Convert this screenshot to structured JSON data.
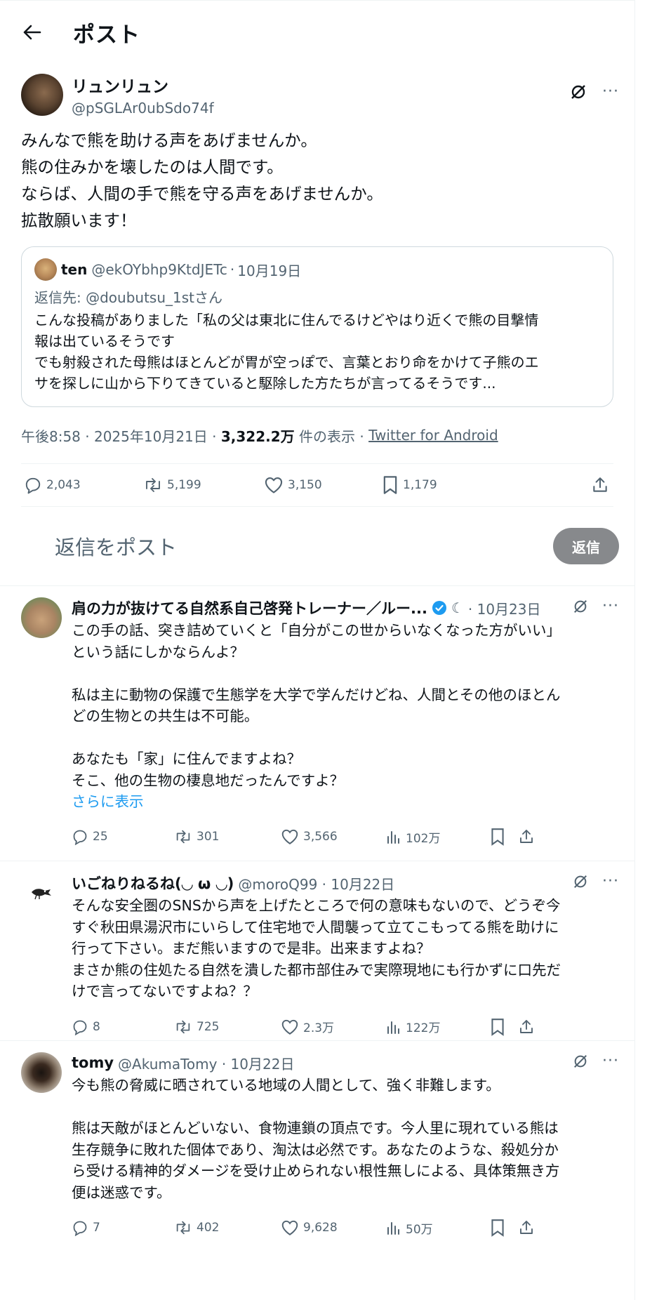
{
  "header": {
    "title": "ポスト"
  },
  "post": {
    "name": "リュンリュン",
    "handle": "@pSGLAr0ubSdo74f",
    "lines": [
      "みんなで熊を助ける声をあげませんか。",
      "熊の住みかを壊したのは人間です。",
      "ならば、人間の手で熊を守る声をあげませんか。",
      "拡散願います！"
    ],
    "quote": {
      "name": "ten",
      "handle": "@ekOYbhp9KtdJETc",
      "date": "10月19日",
      "reply_to": "返信先: @doubutsu_1stさん",
      "line1": "こんな投稿がありました「私の父は東北に住んでるけどやはり近くで熊の目撃情",
      "line2": "報は出ているそうです",
      "line3": "でも射殺された母熊はほとんどが胃が空っぽで、言葉とおり命をかけて子熊のエ",
      "line4": "サを探しに山から下りてきていると駆除した方たちが言ってるそうです..."
    },
    "meta": {
      "time": "午後8:58 · 2025年10月21日 · ",
      "views": "3,322.2万",
      "views_label": " 件の表示 · ",
      "client": "Twitter for Android"
    },
    "stats": {
      "replies": "2,043",
      "reposts": "5,199",
      "likes": "3,150",
      "bookmarks": "1,179"
    }
  },
  "composer": {
    "placeholder": "返信をポスト",
    "button": "返信"
  },
  "replies": [
    {
      "name": "肩の力が抜けてる自然系自己啓発トレーナー／ルー...",
      "meta": "· 10月23日",
      "verified": true,
      "text": "この手の話、突き詰めていくと「自分がこの世からいなくなった方がいい」\nという話にしかならんよ？\n\n私は主に動物の保護で生態学を大学で学んだけどね、人間とその他のほとん\nどの生物との共生は不可能。\n\nあなたも「家」に住んでますよね？\nそこ、他の生物の棲息地だったんですよ？",
      "more": "さらに表示",
      "replies": "25",
      "reposts": "301",
      "likes": "3,566",
      "views": "102万"
    },
    {
      "name": "いごねりねるね(◡ ω ◡)",
      "meta": "@moroQ99 · 10月22日",
      "verified": false,
      "text": "そんな安全圏のSNSから声を上げたところで何の意味もないので、どうぞ今\nすぐ秋田県湯沢市にいらして住宅地で人間襲って立てこもってる熊を助けに\n行って下さい。まだ熊いますので是非。出来ますよね？\nまさか熊の住処たる自然を潰した都市部住みで実際現地にも行かずに口先だ\nけで言ってないですよね？？",
      "more": "",
      "replies": "8",
      "reposts": "725",
      "likes": "2.3万",
      "views": "122万"
    },
    {
      "name": "tomy",
      "meta": "@AkumaTomy · 10月22日",
      "verified": false,
      "text": "今も熊の脅威に晒されている地域の人間として、強く非難します。\n\n熊は天敵がほとんどいない、食物連鎖の頂点です。今人里に現れている熊は\n生存競争に敗れた個体であり、淘汰は必然です。あなたのような、殺処分か\nら受ける精神的ダメージを受け止められない根性無しによる、具体策無き方\n便は迷惑です。",
      "more": "",
      "replies": "7",
      "reposts": "402",
      "likes": "9,628",
      "views": "50万"
    }
  ],
  "colors": {
    "accent": "#1d9bf0",
    "muted": "#536471",
    "button_bg": "#87898c"
  }
}
